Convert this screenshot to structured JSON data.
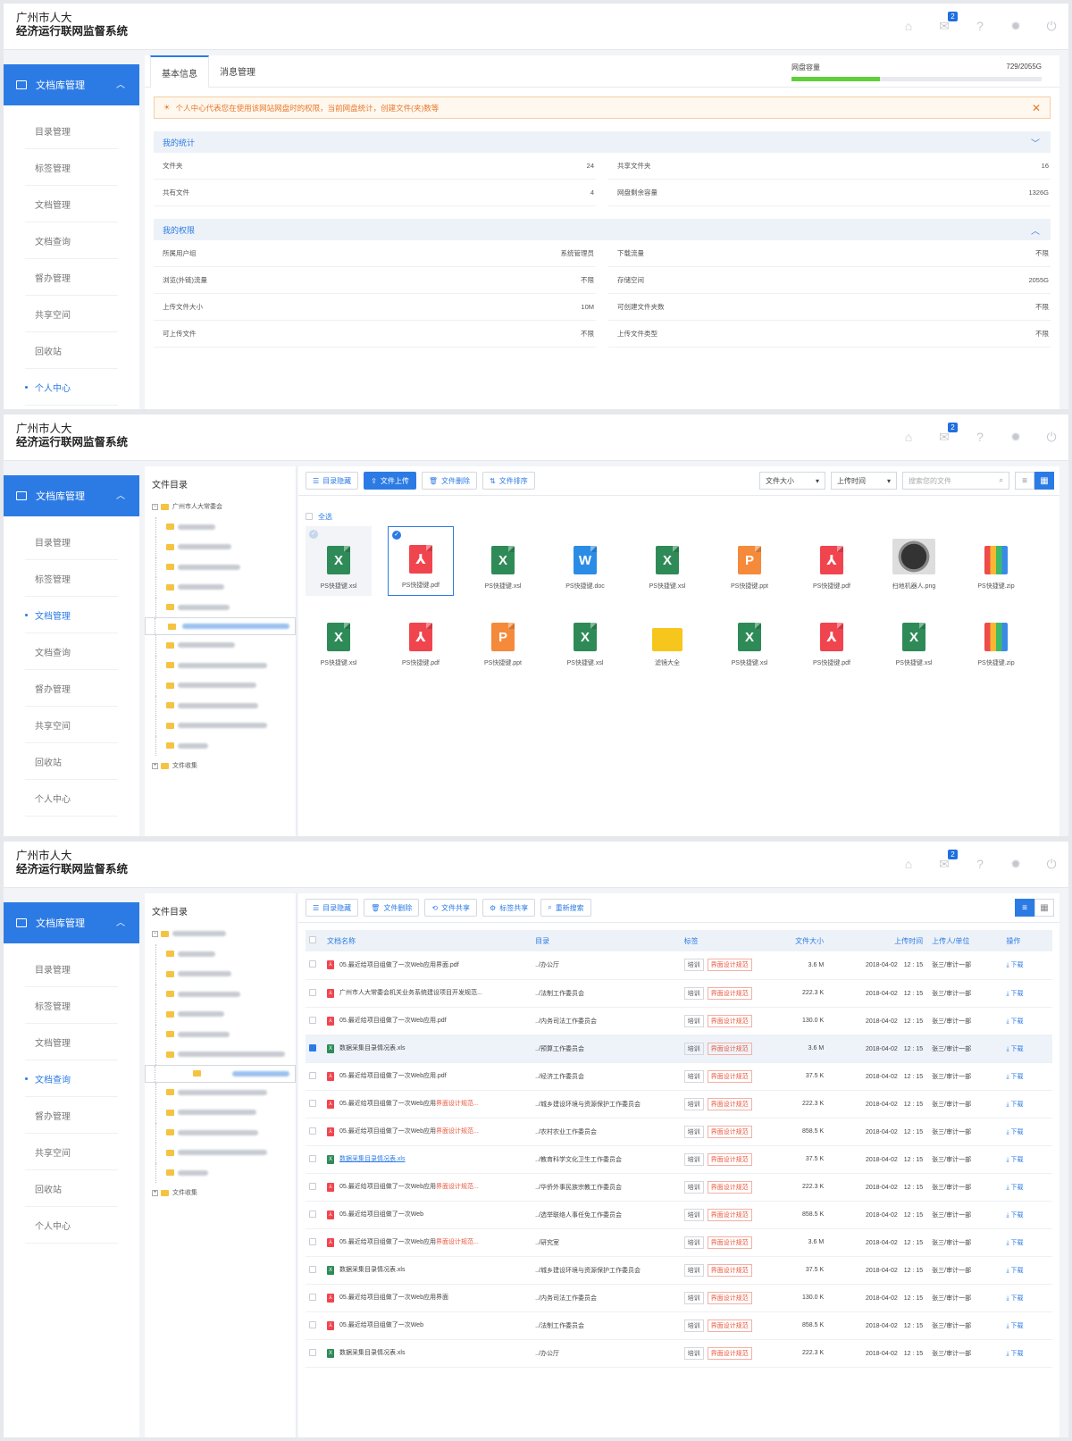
{
  "header": {
    "line1": "广州市人大",
    "line2": "经济运行联网监督系统",
    "msg_count": "2"
  },
  "sidebar": {
    "head": "文档库管理",
    "items": [
      "目录管理",
      "标签管理",
      "文档管理",
      "文档查询",
      "督办管理",
      "共享空间",
      "回收站",
      "个人中心"
    ]
  },
  "panel1": {
    "tabs": [
      "基本信息",
      "消息管理"
    ],
    "disk_label": "网盘容量",
    "disk_value": "729/2055G",
    "disk_fraction": 0.355,
    "alert": "个人中心代表您在使用该网站网盘时的权限，当前网盘统计，创建文件(夹)数等",
    "stats_title": "我的统计",
    "stats": [
      {
        "k": "文件夹",
        "v": "24"
      },
      {
        "k": "共享文件夹",
        "v": "16"
      },
      {
        "k": "共有文件",
        "v": "4"
      },
      {
        "k": "网盘剩余容量",
        "v": "1326G"
      }
    ],
    "perm_title": "我的权限",
    "perms": [
      {
        "k": "所属用户组",
        "v": "系统管理员"
      },
      {
        "k": "下载流量",
        "v": "不限"
      },
      {
        "k": "浏览(外链)流量",
        "v": "不限"
      },
      {
        "k": "存储空间",
        "v": "2055G"
      },
      {
        "k": "上传文件大小",
        "v": "10M"
      },
      {
        "k": "可创建文件夹数",
        "v": "不限"
      },
      {
        "k": "可上传文件",
        "v": "不限"
      },
      {
        "k": "上传文件类型",
        "v": "不限"
      }
    ]
  },
  "panel2": {
    "tree_title": "文件目录",
    "tree_root": "广州市人大常委会",
    "tree_last": "文件收集",
    "toolbar": [
      "目录隐藏",
      "文件上传",
      "文件删除",
      "文件排序"
    ],
    "sort1": "文件大小",
    "sort2": "上传时间",
    "search_placeholder": "搜索您的文件",
    "select_all": "全选",
    "files": [
      {
        "name": "PS快捷键.xsl",
        "type": "x"
      },
      {
        "name": "PS快捷键.pdf",
        "type": "pdf"
      },
      {
        "name": "PS快捷键.xsl",
        "type": "x"
      },
      {
        "name": "PS快捷键.doc",
        "type": "w"
      },
      {
        "name": "PS快捷键.xsl",
        "type": "x"
      },
      {
        "name": "PS快捷键.ppt",
        "type": "p"
      },
      {
        "name": "PS快捷键.pdf",
        "type": "pdf"
      },
      {
        "name": "扫地机器人.png",
        "type": "png"
      },
      {
        "name": "PS快捷键.zip",
        "type": "zip"
      },
      {
        "name": "PS快捷键.xsl",
        "type": "x"
      },
      {
        "name": "PS快捷键.pdf",
        "type": "pdf"
      },
      {
        "name": "PS快捷键.ppt",
        "type": "p"
      },
      {
        "name": "PS快捷键.xsl",
        "type": "x"
      },
      {
        "name": "滤镜大全",
        "type": "folder"
      },
      {
        "name": "PS快捷键.xsl",
        "type": "x"
      },
      {
        "name": "PS快捷键.pdf",
        "type": "pdf"
      },
      {
        "name": "PS快捷键.xsl",
        "type": "x"
      },
      {
        "name": "PS快捷键.zip",
        "type": "zip"
      }
    ]
  },
  "panel3": {
    "toolbar": [
      "目录隐藏",
      "文件删除",
      "文件共享",
      "标签共享",
      "重新搜索"
    ],
    "columns": [
      "文档名称",
      "目录",
      "标签",
      "文件大小",
      "上传时间",
      "上传人/单位",
      "操作"
    ],
    "tag1": "培训",
    "tag2": "界面设计规范",
    "date": "2018-04-02　12 : 15",
    "uploader": "张三/审计一部",
    "download": "下载",
    "rows": [
      {
        "name": "05.最近给项目组做了一次Web应用界面.pdf",
        "dir": "../办公厅",
        "size": "3.6 M",
        "t": "pdf"
      },
      {
        "name": "广州市人大常委会机关业务系统建设项目开发规范...",
        "dir": "../法制工作委员会",
        "size": "222.3 K",
        "t": "pdf"
      },
      {
        "name": "05.最近给项目组做了一次Web应用.pdf",
        "dir": "../内务司法工作委员会",
        "size": "130.0 K",
        "t": "pdf"
      },
      {
        "name": "数据采集目录情况表.xls",
        "dir": "../预算工作委员会",
        "size": "3.6 M",
        "t": "x"
      },
      {
        "name": "05.最近给项目组做了一次Web应用.pdf",
        "dir": "../经济工作委员会",
        "size": "37.5 K",
        "t": "pdf"
      },
      {
        "name": "05.最近给项目组做了一次Web应用",
        "red": "界面设计规范...",
        "dir": "../城乡建设环境与资源保护工作委员会",
        "size": "222.3 K",
        "t": "pdf"
      },
      {
        "name": "05.最近给项目组做了一次Web应用",
        "red": "界面设计规范...",
        "dir": "../农村农业工作委员会",
        "size": "858.5 K",
        "t": "pdf"
      },
      {
        "name": "数据采集目录情况表.xls",
        "dir": "../教育科学文化卫生工作委员会",
        "size": "37.5 K",
        "t": "x"
      },
      {
        "name": "05.最近给项目组做了一次Web应用",
        "red": "界面设计规范...",
        "dir": "../华侨外事民族宗教工作委员会",
        "size": "222.3 K",
        "t": "pdf"
      },
      {
        "name": "05.最近给项目组做了一次Web",
        "dir": "../选举联络人事任免工作委员会",
        "size": "858.5 K",
        "t": "pdf"
      },
      {
        "name": "05.最近给项目组做了一次Web应用",
        "red": "界面设计规范...",
        "dir": "../研究室",
        "size": "3.6 M",
        "t": "pdf"
      },
      {
        "name": "数据采集目录情况表.xls",
        "dir": "../城乡建设环境与资源保护工作委员会",
        "size": "37.5 K",
        "t": "x"
      },
      {
        "name": "05.最近给项目组做了一次Web应用界面",
        "dir": "../内务司法工作委员会",
        "size": "130.0 K",
        "t": "pdf"
      },
      {
        "name": "05.最近给项目组做了一次Web",
        "dir": "../法制工作委员会",
        "size": "858.5 K",
        "t": "pdf"
      },
      {
        "name": "数据采集目录情况表.xls",
        "dir": "../办公厅",
        "size": "222.3 K",
        "t": "x"
      }
    ]
  },
  "colors": {
    "accent": "#2c7be5",
    "excel": "#2e8b57",
    "pdf": "#f0454f",
    "word": "#2b8ce6",
    "ppt": "#f58a3b",
    "folder": "#f7c61d"
  }
}
